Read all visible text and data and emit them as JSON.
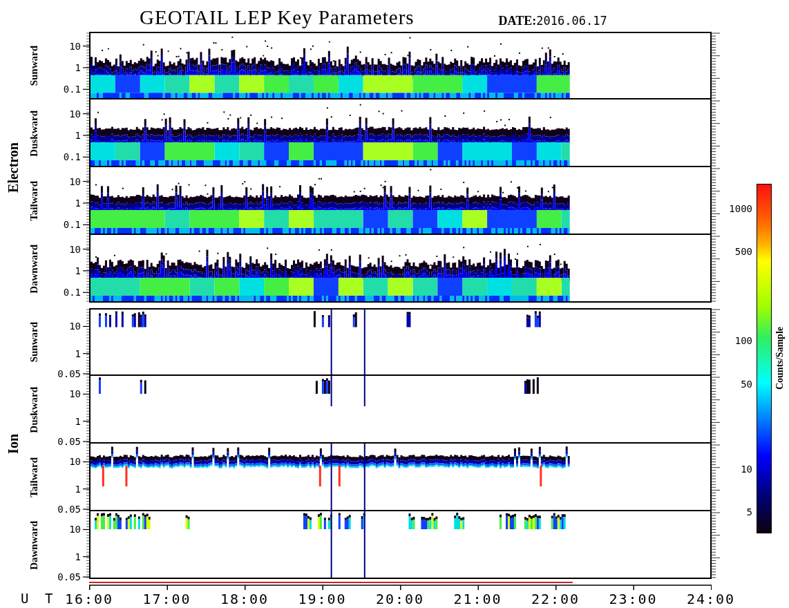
{
  "title": "GEOTAIL LEP Key Parameters",
  "date": {
    "label": "DATE:",
    "value": "2016.06.17"
  },
  "groups": [
    {
      "name": "Electron",
      "kind": "electron",
      "panels": [
        {
          "name": "Sunward",
          "yticks": [
            "10",
            "1",
            "0.1"
          ]
        },
        {
          "name": "Duskward",
          "yticks": [
            "10",
            "1",
            "0.1"
          ]
        },
        {
          "name": "Tailward",
          "yticks": [
            "10",
            "1",
            "0.1"
          ]
        },
        {
          "name": "Dawnward",
          "yticks": [
            "10",
            "1",
            "0.1"
          ]
        }
      ]
    },
    {
      "name": "Ion",
      "kind": "ion",
      "panels": [
        {
          "name": "Sunward",
          "yticks": [
            "10",
            "1",
            "0.05"
          ]
        },
        {
          "name": "Duskward",
          "yticks": [
            "10",
            "1",
            "0.05"
          ]
        },
        {
          "name": "Tailward",
          "yticks": [
            "10",
            "1",
            "0.05"
          ]
        },
        {
          "name": "Dawnward",
          "yticks": [
            "10",
            "1",
            "0.05"
          ]
        }
      ]
    }
  ],
  "x_axis": {
    "label": "U T",
    "ticks": [
      "16:00",
      "17:00",
      "18:00",
      "19:00",
      "20:00",
      "21:00",
      "22:00",
      "23:00",
      "24:00"
    ]
  },
  "colorbar": {
    "label": "Counts/Sample",
    "ticks": [
      "1000",
      "500",
      "100",
      "50",
      "10",
      "5"
    ]
  }
}
